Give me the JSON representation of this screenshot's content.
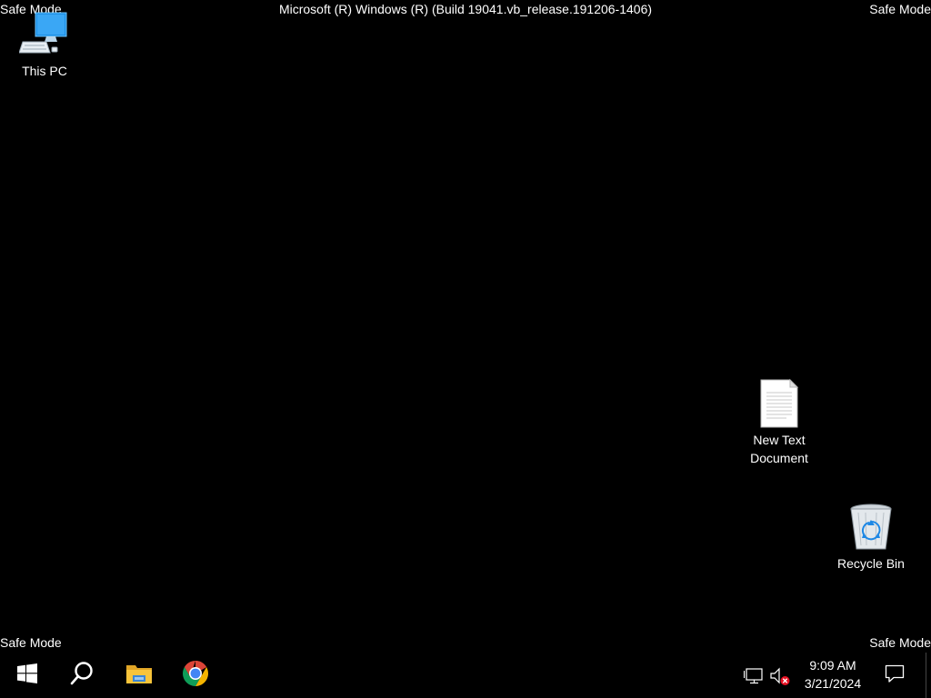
{
  "overlay": {
    "safe_mode_top_left": "Safe Mode",
    "safe_mode_top_right": "Safe Mode",
    "safe_mode_bottom_left": "Safe Mode",
    "safe_mode_bottom_right": "Safe Mode",
    "build_info": "Microsoft (R) Windows (R) (Build 19041.vb_release.191206-1406)"
  },
  "desktop": {
    "icons": [
      {
        "label": "This PC",
        "icon": "computer-icon"
      },
      {
        "label": "New Text Document",
        "icon": "text-document-icon"
      },
      {
        "label": "Recycle Bin",
        "icon": "recycle-bin-icon"
      }
    ]
  },
  "taskbar": {
    "pinned": [
      {
        "icon": "windows-start-icon"
      },
      {
        "icon": "search-icon"
      },
      {
        "icon": "file-explorer-icon"
      },
      {
        "icon": "chrome-icon"
      }
    ],
    "tray": {
      "network_icon": "network-icon",
      "volume_icon": "volume-muted-icon",
      "time": "9:09 AM",
      "date": "3/21/2024",
      "notification_icon": "notification-icon"
    }
  },
  "colors": {
    "background": "#000000",
    "text": "#ffffff",
    "accent_blue": "#0078d7",
    "folder_yellow": "#f8c43a",
    "muted_red": "#e81123"
  }
}
